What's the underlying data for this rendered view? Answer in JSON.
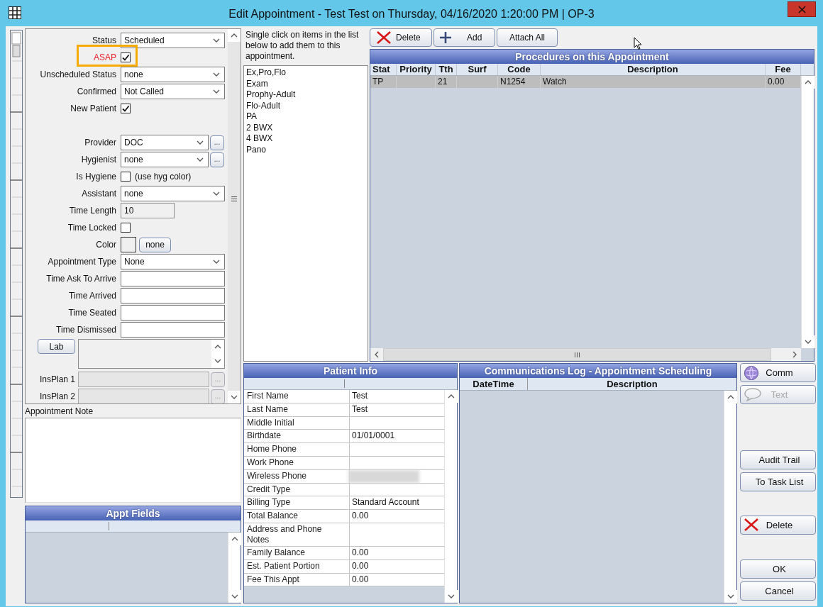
{
  "window": {
    "title": "Edit Appointment - Test Test on Thursday, 04/16/2020 1:20:00 PM | OP-3"
  },
  "form": {
    "sections": [
      {
        "fields": [
          {
            "kind": "select",
            "label": "Status",
            "value": "Scheduled"
          },
          {
            "kind": "check",
            "label": "ASAP",
            "checked": true,
            "alert": true,
            "highlighted": true
          },
          {
            "kind": "select",
            "label": "Unscheduled Status",
            "value": "none"
          },
          {
            "kind": "select",
            "label": "Confirmed",
            "value": "Not Called"
          },
          {
            "kind": "check",
            "label": "New Patient",
            "checked": true,
            "alert": false,
            "highlighted": false
          }
        ]
      },
      {
        "fields": [
          {
            "kind": "select_more",
            "label": "Provider",
            "value": "DOC",
            "more": "..."
          },
          {
            "kind": "select_more",
            "label": "Hygienist",
            "value": "none",
            "more": "..."
          },
          {
            "kind": "check",
            "label": "Is Hygiene",
            "checked": false,
            "alert": false,
            "highlighted": false,
            "note": "(use hyg color)"
          },
          {
            "kind": "select",
            "label": "Assistant",
            "value": "none"
          },
          {
            "kind": "readonly",
            "label": "Time Length",
            "value": "10"
          },
          {
            "kind": "check",
            "label": "Time Locked",
            "checked": false,
            "alert": false,
            "highlighted": false
          },
          {
            "kind": "color",
            "label": "Color",
            "button": "none"
          },
          {
            "kind": "select",
            "label": "Appointment Type",
            "value": "None"
          },
          {
            "kind": "text",
            "label": "Time Ask To Arrive"
          },
          {
            "kind": "text",
            "label": "Time Arrived"
          },
          {
            "kind": "text",
            "label": "Time Seated"
          },
          {
            "kind": "text",
            "label": "Time Dismissed"
          },
          {
            "kind": "lab",
            "button": "Lab"
          },
          {
            "kind": "insplan",
            "label": "InsPlan 1",
            "more": "..."
          },
          {
            "kind": "insplan",
            "label": "InsPlan 2",
            "more": "..."
          }
        ]
      }
    ]
  },
  "appointment_note": {
    "label": "Appointment Note"
  },
  "appt_fields": {
    "title": "Appt Fields"
  },
  "quick_add": {
    "instructions": "Single click on items in the list below to add them to this appointment.",
    "items": [
      "Ex,Pro,Flo",
      "Exam",
      "Prophy-Adult",
      "Flo-Adult",
      "PA",
      "2 BWX",
      "4 BWX",
      "Pano"
    ]
  },
  "toolbar": [
    {
      "kind": "delete",
      "label": "Delete"
    },
    {
      "kind": "add",
      "label": "Add"
    },
    {
      "kind": "plain",
      "label": "Attach All"
    }
  ],
  "procedures": {
    "title": "Procedures on this Appointment",
    "columns": [
      "Stat",
      "Priority",
      "Tth",
      "Surf",
      "Code",
      "Description",
      "Fee"
    ],
    "rows": [
      {
        "selected": true,
        "cells": [
          "TP",
          "",
          "21",
          "",
          "N1254",
          "Watch",
          "0.00"
        ]
      }
    ]
  },
  "patient_info": {
    "title": "Patient Info",
    "rows": [
      {
        "label": "First Name",
        "value": "Test",
        "redacted": false
      },
      {
        "label": "Last Name",
        "value": "Test",
        "redacted": false
      },
      {
        "label": "Middle Initial",
        "redacted": false
      },
      {
        "label": "Birthdate",
        "value": "01/01/0001",
        "redacted": false
      },
      {
        "label": "Home Phone",
        "redacted": false
      },
      {
        "label": "Work Phone",
        "redacted": false
      },
      {
        "label": "Wireless Phone",
        "redacted": true
      },
      {
        "label": "Credit Type",
        "redacted": false
      },
      {
        "label": "Billing Type",
        "value": "Standard Account",
        "redacted": false
      },
      {
        "label": "Total Balance",
        "value": "0.00",
        "redacted": false
      },
      {
        "label": "Address and Phone Notes",
        "redacted": false
      },
      {
        "label": "Family Balance",
        "value": "0.00",
        "redacted": false
      },
      {
        "label": "Est. Patient Portion",
        "value": "0.00",
        "redacted": false
      },
      {
        "label": "Fee This Appt",
        "value": "0.00",
        "redacted": false
      }
    ]
  },
  "comm_log": {
    "title": "Communications Log - Appointment Scheduling",
    "columns": [
      "DateTime",
      "Description"
    ]
  },
  "side_buttons": [
    [
      {
        "kind": "comm",
        "label": "Comm",
        "disabled": false
      },
      {
        "kind": "text",
        "label": "Text",
        "disabled": true
      }
    ],
    [
      {
        "kind": "plain",
        "label": "Audit Trail",
        "disabled": false
      },
      {
        "kind": "plain",
        "label": "To Task List",
        "disabled": false
      }
    ],
    [
      {
        "kind": "delete",
        "label": "Delete",
        "disabled": false
      }
    ],
    [
      {
        "kind": "plain",
        "label": "OK",
        "disabled": false
      },
      {
        "kind": "plain",
        "label": "Cancel",
        "disabled": false
      }
    ]
  ]
}
